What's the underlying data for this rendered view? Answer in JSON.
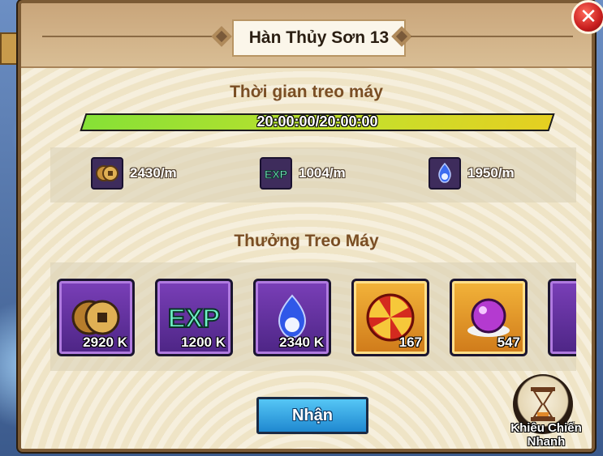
{
  "dialog": {
    "title": "Hàn Thủy Sơn 13",
    "close_icon": "close-icon"
  },
  "idle_time": {
    "label": "Thời gian treo máy",
    "value": "20:00:00/20:00:00",
    "progress_fraction": 1.0
  },
  "rates": [
    {
      "icon": "coin-icon",
      "value": "2430/m"
    },
    {
      "icon": "exp-icon",
      "value": "1004/m"
    },
    {
      "icon": "spirit-flame-icon",
      "value": "1950/m"
    }
  ],
  "rewards": {
    "label": "Thưởng Treo Máy",
    "items": [
      {
        "icon": "coin-icon",
        "quantity": "2920 K",
        "rarity_color": "#7a3fb8"
      },
      {
        "icon": "exp-icon",
        "quantity": "1200 K",
        "rarity_color": "#7a3fb8"
      },
      {
        "icon": "spirit-flame-icon",
        "quantity": "2340 K",
        "rarity_color": "#7a3fb8"
      },
      {
        "icon": "swirl-orb-icon",
        "quantity": "167",
        "rarity_color": "#f3b43a"
      },
      {
        "icon": "purple-orb-icon",
        "quantity": "547",
        "rarity_color": "#f3b43a"
      }
    ]
  },
  "claim_button": {
    "label": "Nhận"
  },
  "quick_fight": {
    "label": "Khiêu Chiến Nhanh",
    "icon": "hourglass-icon"
  },
  "colors": {
    "panel_bg": "#f4ecd7",
    "accent_brown": "#7a4e24",
    "button_blue": "#1f88d0",
    "progress_green": "#86e136"
  }
}
